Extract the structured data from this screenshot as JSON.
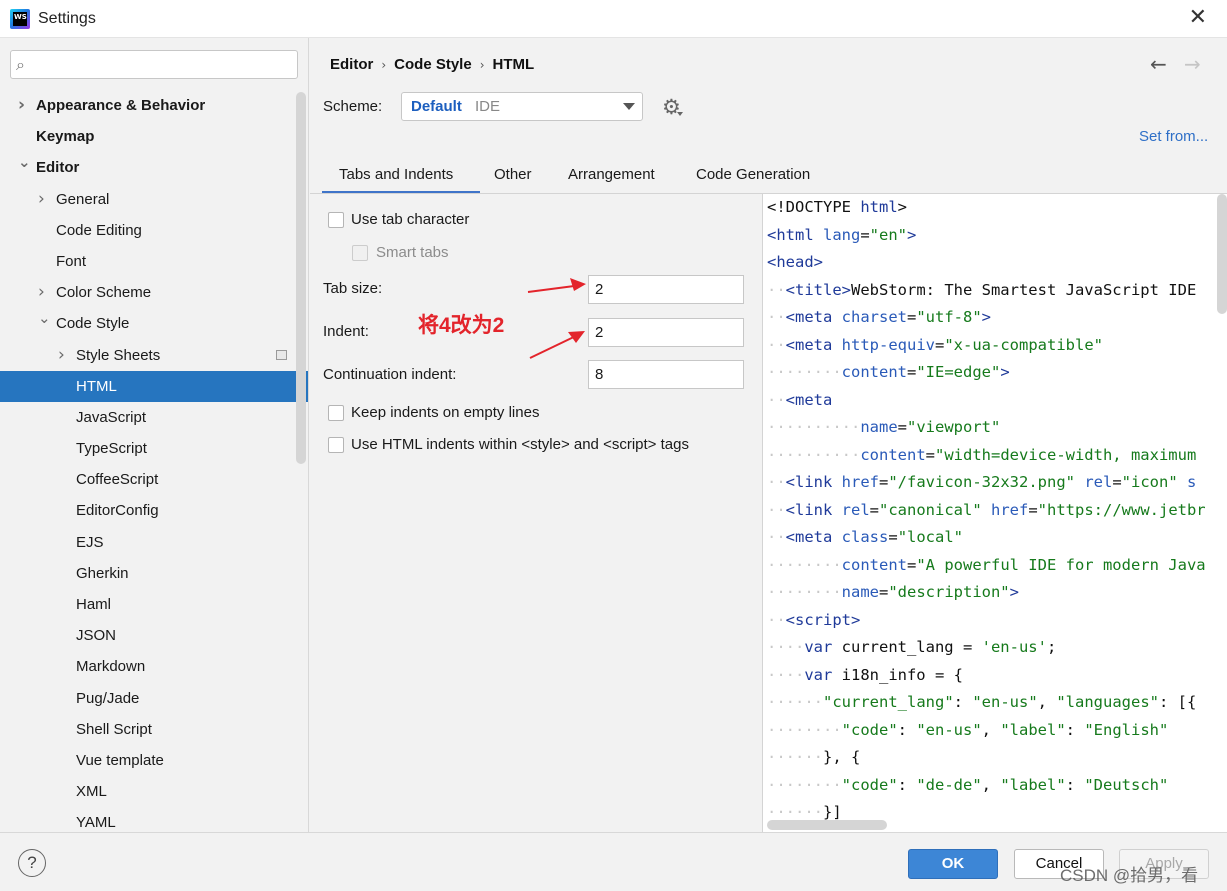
{
  "window": {
    "title": "Settings",
    "app_icon": "webstorm-logo",
    "app_icon_text": "WS",
    "close_glyph": "✕"
  },
  "sidebar": {
    "search": {
      "placeholder": "",
      "value": ""
    },
    "items": [
      {
        "label": "Appearance & Behavior",
        "level": 0,
        "bold": true,
        "chevron": "right"
      },
      {
        "label": "Keymap",
        "level": 0,
        "bold": true,
        "chevron": "none"
      },
      {
        "label": "Editor",
        "level": 0,
        "bold": true,
        "chevron": "down"
      },
      {
        "label": "General",
        "level": 1,
        "chevron": "right"
      },
      {
        "label": "Code Editing",
        "level": 1,
        "chevron": "none"
      },
      {
        "label": "Font",
        "level": 1,
        "chevron": "none"
      },
      {
        "label": "Color Scheme",
        "level": 1,
        "chevron": "right"
      },
      {
        "label": "Code Style",
        "level": 1,
        "chevron": "down"
      },
      {
        "label": "Style Sheets",
        "level": 2,
        "chevron": "right",
        "doc_icon": true
      },
      {
        "label": "HTML",
        "level": 2,
        "chevron": "none",
        "selected": true
      },
      {
        "label": "JavaScript",
        "level": 2,
        "chevron": "none"
      },
      {
        "label": "TypeScript",
        "level": 2,
        "chevron": "none"
      },
      {
        "label": "CoffeeScript",
        "level": 2,
        "chevron": "none"
      },
      {
        "label": "EditorConfig",
        "level": 2,
        "chevron": "none"
      },
      {
        "label": "EJS",
        "level": 2,
        "chevron": "none"
      },
      {
        "label": "Gherkin",
        "level": 2,
        "chevron": "none"
      },
      {
        "label": "Haml",
        "level": 2,
        "chevron": "none"
      },
      {
        "label": "JSON",
        "level": 2,
        "chevron": "none"
      },
      {
        "label": "Markdown",
        "level": 2,
        "chevron": "none"
      },
      {
        "label": "Pug/Jade",
        "level": 2,
        "chevron": "none"
      },
      {
        "label": "Shell Script",
        "level": 2,
        "chevron": "none"
      },
      {
        "label": "Vue template",
        "level": 2,
        "chevron": "none"
      },
      {
        "label": "XML",
        "level": 2,
        "chevron": "none"
      },
      {
        "label": "YAML",
        "level": 2,
        "chevron": "none"
      }
    ]
  },
  "breadcrumb": [
    "Editor",
    "Code Style",
    "HTML"
  ],
  "nav": {
    "back_glyph": "←",
    "forward_glyph": "→"
  },
  "scheme": {
    "label": "Scheme:",
    "name": "Default",
    "kind": "IDE",
    "link": "Set from..."
  },
  "tabs": [
    {
      "label": "Tabs and Indents",
      "active": true
    },
    {
      "label": "Other",
      "active": false
    },
    {
      "label": "Arrangement",
      "active": false
    },
    {
      "label": "Code Generation",
      "active": false
    }
  ],
  "options": {
    "use_tab_character": {
      "label": "Use tab character",
      "checked": false
    },
    "smart_tabs": {
      "label": "Smart tabs",
      "checked": false,
      "disabled": true
    },
    "tab_size": {
      "label": "Tab size:",
      "value": "2"
    },
    "indent": {
      "label": "Indent:",
      "value": "2"
    },
    "continuation_indent": {
      "label": "Continuation indent:",
      "value": "8"
    },
    "keep_indents_empty": {
      "label": "Keep indents on empty lines",
      "checked": false
    },
    "use_html_indents": {
      "label": "Use HTML indents within <style> and <script> tags",
      "checked": false
    }
  },
  "annotation": {
    "text": "将4改为2",
    "color": "#e3242b"
  },
  "preview": {
    "lines": [
      [
        [
          "pl",
          "<!DOCTYPE "
        ],
        [
          "tg",
          "html"
        ],
        [
          "pl",
          ">"
        ]
      ],
      [
        [
          "tg",
          "<html "
        ],
        [
          "at",
          "lang"
        ],
        [
          "pl",
          "="
        ],
        [
          "st",
          "\"en\""
        ],
        [
          "tg",
          ">"
        ]
      ],
      [
        [
          "tg",
          "<head>"
        ]
      ],
      [
        [
          "ws",
          "··"
        ],
        [
          "tg",
          "<title>"
        ],
        [
          "pl",
          "WebStorm: The Smartest JavaScript IDE"
        ]
      ],
      [
        [
          "ws",
          "··"
        ],
        [
          "tg",
          "<meta "
        ],
        [
          "at",
          "charset"
        ],
        [
          "pl",
          "="
        ],
        [
          "st",
          "\"utf-8\""
        ],
        [
          "tg",
          ">"
        ]
      ],
      [
        [
          "ws",
          "··"
        ],
        [
          "tg",
          "<meta "
        ],
        [
          "at",
          "http-equiv"
        ],
        [
          "pl",
          "="
        ],
        [
          "st",
          "\"x-ua-compatible\""
        ]
      ],
      [
        [
          "ws",
          "········"
        ],
        [
          "at",
          "content"
        ],
        [
          "pl",
          "="
        ],
        [
          "st",
          "\"IE=edge\""
        ],
        [
          "tg",
          ">"
        ]
      ],
      [
        [
          "ws",
          "··"
        ],
        [
          "tg",
          "<meta"
        ]
      ],
      [
        [
          "ws",
          "··········"
        ],
        [
          "at",
          "name"
        ],
        [
          "pl",
          "="
        ],
        [
          "st",
          "\"viewport\""
        ]
      ],
      [
        [
          "ws",
          "··········"
        ],
        [
          "at",
          "content"
        ],
        [
          "pl",
          "="
        ],
        [
          "st",
          "\"width=device-width, maximum"
        ]
      ],
      [
        [
          "ws",
          "··"
        ],
        [
          "tg",
          "<link "
        ],
        [
          "at",
          "href"
        ],
        [
          "pl",
          "="
        ],
        [
          "st",
          "\"/favicon-32x32.png\" "
        ],
        [
          "at",
          "rel"
        ],
        [
          "pl",
          "="
        ],
        [
          "st",
          "\"icon\" "
        ],
        [
          "at",
          "s"
        ]
      ],
      [
        [
          "ws",
          "··"
        ],
        [
          "tg",
          "<link "
        ],
        [
          "at",
          "rel"
        ],
        [
          "pl",
          "="
        ],
        [
          "st",
          "\"canonical\" "
        ],
        [
          "at",
          "href"
        ],
        [
          "pl",
          "="
        ],
        [
          "st",
          "\"https://www.jetbr"
        ]
      ],
      [
        [
          "ws",
          "··"
        ],
        [
          "tg",
          "<meta "
        ],
        [
          "at",
          "class"
        ],
        [
          "pl",
          "="
        ],
        [
          "st",
          "\"local\""
        ]
      ],
      [
        [
          "ws",
          "········"
        ],
        [
          "at",
          "content"
        ],
        [
          "pl",
          "="
        ],
        [
          "st",
          "\"A powerful IDE for modern Java"
        ]
      ],
      [
        [
          "ws",
          "········"
        ],
        [
          "at",
          "name"
        ],
        [
          "pl",
          "="
        ],
        [
          "st",
          "\"description\""
        ],
        [
          "tg",
          ">"
        ]
      ],
      [
        [
          "ws",
          "··"
        ],
        [
          "tg",
          "<script>"
        ]
      ],
      [
        [
          "ws",
          "····"
        ],
        [
          "kw",
          "var "
        ],
        [
          "pl",
          "current_lang = "
        ],
        [
          "st",
          "'en-us'"
        ],
        [
          "pl",
          ";"
        ]
      ],
      [
        [
          "ws",
          "····"
        ],
        [
          "kw",
          "var "
        ],
        [
          "pl",
          "i18n_info = {"
        ]
      ],
      [
        [
          "ws",
          "······"
        ],
        [
          "st",
          "\"current_lang\""
        ],
        [
          "pl",
          ": "
        ],
        [
          "st",
          "\"en-us\""
        ],
        [
          "pl",
          ", "
        ],
        [
          "st",
          "\"languages\""
        ],
        [
          "pl",
          ": [{"
        ]
      ],
      [
        [
          "ws",
          "········"
        ],
        [
          "st",
          "\"code\""
        ],
        [
          "pl",
          ": "
        ],
        [
          "st",
          "\"en-us\""
        ],
        [
          "pl",
          ", "
        ],
        [
          "st",
          "\"label\""
        ],
        [
          "pl",
          ": "
        ],
        [
          "st",
          "\"English\""
        ]
      ],
      [
        [
          "ws",
          "······"
        ],
        [
          "pl",
          "}, {"
        ]
      ],
      [
        [
          "ws",
          "········"
        ],
        [
          "st",
          "\"code\""
        ],
        [
          "pl",
          ": "
        ],
        [
          "st",
          "\"de-de\""
        ],
        [
          "pl",
          ", "
        ],
        [
          "st",
          "\"label\""
        ],
        [
          "pl",
          ": "
        ],
        [
          "st",
          "\"Deutsch\""
        ]
      ],
      [
        [
          "ws",
          "······"
        ],
        [
          "pl",
          "}]"
        ]
      ]
    ]
  },
  "footer": {
    "help_glyph": "?",
    "ok_label": "OK",
    "cancel_label": "Cancel",
    "apply_label": "Apply",
    "watermark": "CSDN @拾男，看"
  }
}
